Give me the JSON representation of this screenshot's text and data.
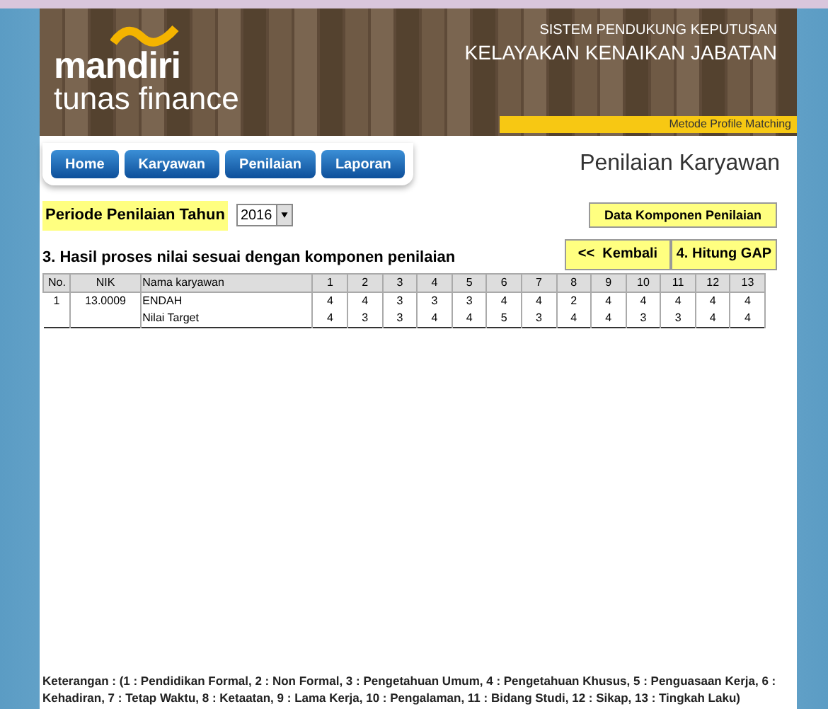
{
  "header": {
    "logo_top": "mandiri",
    "logo_bottom": "tunas finance",
    "subtitle": "SISTEM PENDUKUNG KEPUTUSAN",
    "title": "KELAYAKAN KENAIKAN JABATAN",
    "method": "Metode Profile Matching"
  },
  "nav": [
    "Home",
    "Karyawan",
    "Penilaian",
    "Laporan"
  ],
  "page_title": "Penilaian Karyawan",
  "period": {
    "label": "Periode Penilaian Tahun",
    "value": "2016"
  },
  "buttons": {
    "components": "Data Komponen Penilaian",
    "back": "<<  Kembali",
    "gap": "4. Hitung GAP"
  },
  "section_title": "3.  Hasil proses nilai sesuai dengan komponen penilaian",
  "table": {
    "columns": [
      "No.",
      "NIK",
      "Nama karyawan",
      "1",
      "2",
      "3",
      "4",
      "5",
      "6",
      "7",
      "8",
      "9",
      "10",
      "11",
      "12",
      "13"
    ],
    "rows": [
      [
        "1",
        "13.0009",
        "ENDAH",
        "4",
        "4",
        "3",
        "3",
        "3",
        "4",
        "4",
        "2",
        "4",
        "4",
        "4",
        "4",
        "4"
      ],
      [
        "",
        "",
        "Nilai Target",
        "4",
        "3",
        "3",
        "4",
        "4",
        "5",
        "3",
        "4",
        "4",
        "3",
        "3",
        "4",
        "4"
      ]
    ]
  },
  "legend": "Keterangan : (1 : Pendidikan Formal, 2 : Non Formal, 3 : Pengetahuan Umum, 4 : Pengetahuan Khusus, 5 : Penguasaan Kerja, 6 : Kehadiran, 7 : Tetap Waktu, 8 : Ketaatan, 9 : Lama Kerja, 10 : Pengalaman, 11 : Bidang Studi, 12 : Sikap, 13 : Tingkah Laku)"
}
